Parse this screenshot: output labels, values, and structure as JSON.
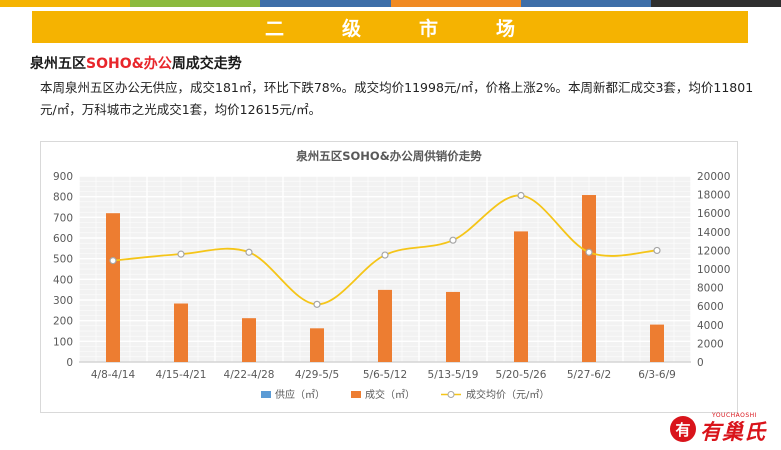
{
  "banner": {
    "title": "二级市场"
  },
  "colors": {
    "banner": "#f5b301",
    "accent": "#e8262b",
    "supply": "#5b9bd5",
    "deals": "#ed7d31",
    "price": "#f5c518",
    "topbar": [
      "#f5b301",
      "#8bba3e",
      "#3d6ea8",
      "#f08a24",
      "#3d6ea8",
      "#2f2f2f"
    ]
  },
  "heading": {
    "prefix": "泉州五区",
    "accent": "SOHO&办公",
    "suffix": "周成交走势"
  },
  "paragraph": "本周泉州五区办公无供应，成交181㎡，环比下跌78%。成交均价11998元/㎡，价格上涨2%。本周新都汇成交3套，均价11801元/㎡，万科城市之光成交1套，均价12615元/㎡。",
  "chart_data": {
    "type": "bar",
    "title": "泉州五区SOHO&办公周供销价走势",
    "categories": [
      "4/8-4/14",
      "4/15-4/21",
      "4/22-4/28",
      "4/29-5/5",
      "5/6-5/12",
      "5/13-5/19",
      "5/20-5/26",
      "5/27-6/2",
      "6/3-6/9"
    ],
    "series": [
      {
        "name": "供应（㎡）",
        "type": "bar",
        "axis": "left",
        "values": [
          0,
          0,
          0,
          0,
          0,
          0,
          0,
          0,
          0
        ]
      },
      {
        "name": "成交（㎡）",
        "type": "bar",
        "axis": "left",
        "values": [
          720,
          283,
          212,
          163,
          349,
          339,
          632,
          808,
          181
        ]
      },
      {
        "name": "成交均价（元/㎡）",
        "type": "line",
        "axis": "right",
        "values": [
          10900,
          11600,
          11800,
          6200,
          11500,
          13100,
          17900,
          11800,
          11998
        ]
      }
    ],
    "y_left": {
      "min": 0,
      "max": 900,
      "ticks": [
        "0",
        "100",
        "200",
        "300",
        "400",
        "500",
        "600",
        "700",
        "800",
        "900"
      ]
    },
    "y_right": {
      "min": 0,
      "max": 20000,
      "ticks": [
        "0",
        "2000",
        "4000",
        "6000",
        "8000",
        "10000",
        "12000",
        "14000",
        "16000",
        "18000",
        "20000"
      ]
    },
    "grid": true,
    "legend": "bottom"
  },
  "logo": {
    "name": "有巢氏",
    "small": "YOUCHAOSHI",
    "mark": "有"
  }
}
